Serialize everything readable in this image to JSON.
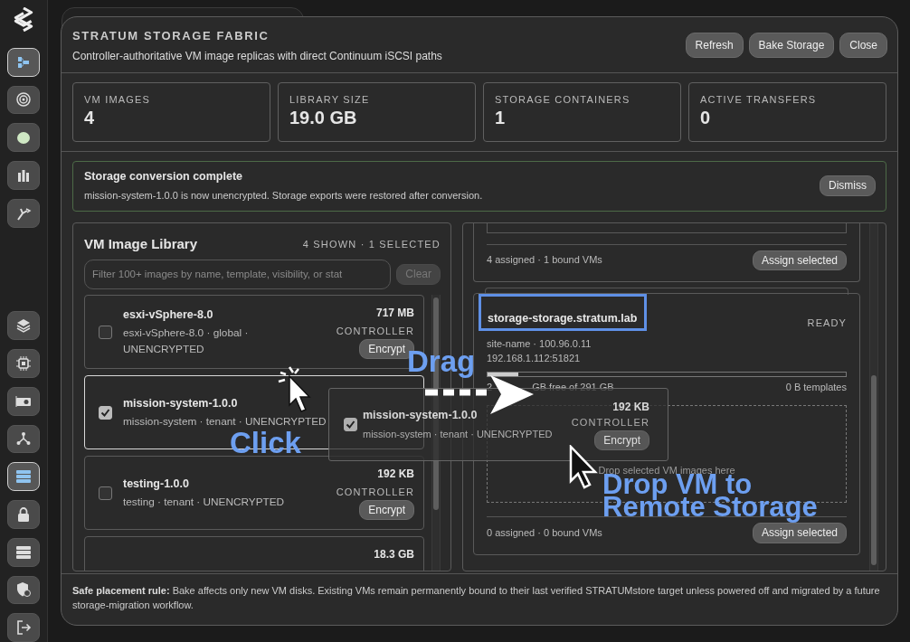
{
  "sidebar": {
    "items": [
      {
        "kind": "org",
        "selected": true
      },
      {
        "kind": "target",
        "selected": false
      },
      {
        "kind": "blob",
        "selected": false
      },
      {
        "kind": "bars",
        "selected": false
      },
      {
        "kind": "arm",
        "selected": false
      },
      {
        "kind": "layers",
        "selected": false
      },
      {
        "kind": "chip",
        "selected": false
      },
      {
        "kind": "card",
        "selected": false
      },
      {
        "kind": "network",
        "selected": false
      },
      {
        "kind": "storage",
        "selected": true
      },
      {
        "kind": "lock",
        "selected": false
      },
      {
        "kind": "servers",
        "selected": false
      },
      {
        "kind": "shield",
        "selected": false
      },
      {
        "kind": "logout",
        "selected": false
      }
    ]
  },
  "modal": {
    "title": "STRATUM STORAGE FABRIC",
    "subtitle": "Controller-authoritative VM image replicas with direct Continuum iSCSI paths",
    "buttons": [
      "Refresh",
      "Bake Storage",
      "Close"
    ]
  },
  "stats": [
    {
      "label": "VM IMAGES",
      "value": "4"
    },
    {
      "label": "LIBRARY SIZE",
      "value": "19.0 GB"
    },
    {
      "label": "STORAGE CONTAINERS",
      "value": "1"
    },
    {
      "label": "ACTIVE TRANSFERS",
      "value": "0"
    }
  ],
  "alert": {
    "title": "Storage conversion complete",
    "message": "mission-system-1.0.0 is now unencrypted. Storage exports were restored after conversion.",
    "button": "Dismiss"
  },
  "library": {
    "title": "VM Image Library",
    "summary": "4 SHOWN · 1 SELECTED",
    "search": {
      "placeholder": "Filter 100+ images by name, template, visibility, or stat"
    },
    "clear_button": {
      "label": "Clear",
      "disabled": true
    },
    "items": [
      {
        "name": "esxi-vSphere-8.0",
        "meta": "esxi-vSphere-8.0 · global · UNENCRYPTED",
        "size": "717 MB",
        "location": "CONTROLLER",
        "button": "Encrypt",
        "checked": false,
        "selected": false
      },
      {
        "name": "mission-system-1.0.0",
        "meta": "mission-system · tenant · UNENCRYPTED",
        "checked": true,
        "selected": true
      },
      {
        "name": "testing-1.0.0",
        "meta": "testing · tenant · UNENCRYPTED",
        "size": "192 KB",
        "location": "CONTROLLER",
        "button": "Encrypt",
        "checked": false,
        "selected": false
      },
      {
        "size": "18.3 GB"
      }
    ]
  },
  "storage": {
    "containers": [
      {
        "kind": "partial",
        "summary": "4 assigned · 1 bound VMs",
        "button": "Assign selected"
      },
      {
        "kind": "full",
        "title": "storage-storage.stratum.lab",
        "highlighted": true,
        "status": "READY",
        "meta": "site-name · 100.96.0.11",
        "address": "192.168.1.112:51821",
        "level": 0.085,
        "capacity_lead": "2",
        "capacity_rest": "GB free of 291 GB",
        "templates": "0 B templates",
        "drop_hint": "Drop selected VM images here",
        "summary": "0 assigned · 0 bound VMs",
        "button": "Assign selected"
      }
    ]
  },
  "drag_ghost": {
    "name": "mission-system-1.0.0",
    "meta": "mission-system · tenant · UNENCRYPTED",
    "size": "192 KB",
    "location": "CONTROLLER",
    "button": "Encrypt",
    "checked": true
  },
  "annotations": [
    {
      "kind": "drag",
      "lines": [
        "Drag"
      ]
    },
    {
      "kind": "click",
      "lines": [
        "Click"
      ]
    },
    {
      "kind": "drop",
      "lines": [
        "Drop VM to",
        "Remote Storage"
      ]
    }
  ],
  "footer": {
    "text": "**Safe placement rule:** Bake affects only new VM disks. Existing VMs remain permanently bound to their last verified STRATUMstore target unless powered off and migrated by a future storage-migration workflow."
  }
}
